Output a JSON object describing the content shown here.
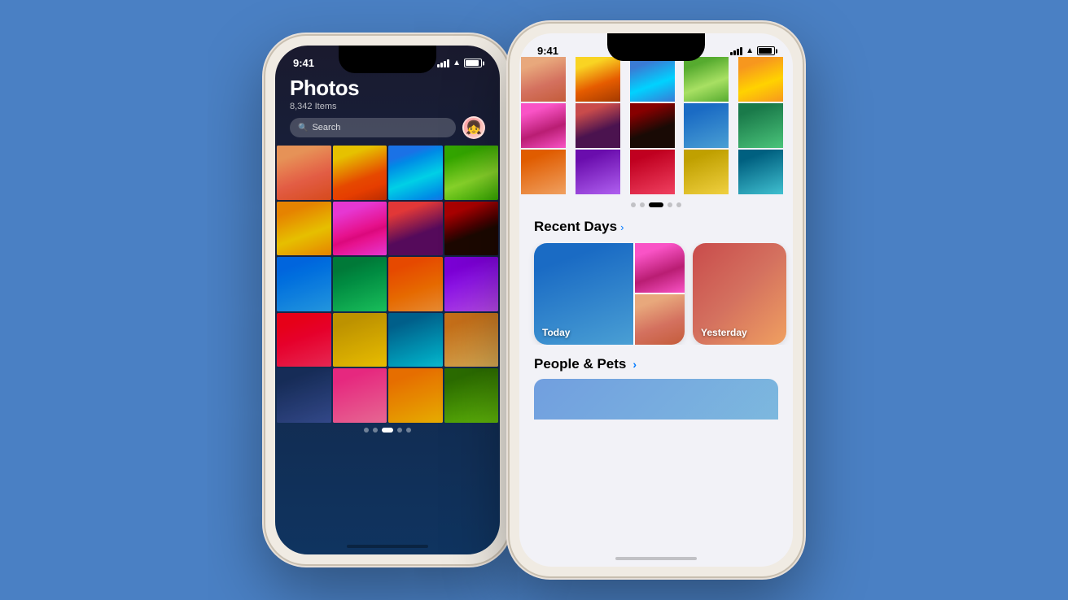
{
  "background_color": "#4a80c4",
  "left_phone": {
    "status": {
      "time": "9:41",
      "signal": "full",
      "wifi": true,
      "battery": "full"
    },
    "title": "Photos",
    "item_count": "8,342 Items",
    "search_placeholder": "Search",
    "dot_indicators": [
      "dot",
      "dot",
      "active",
      "dot",
      "dot"
    ],
    "photos": [
      {
        "color": "photo-warm1"
      },
      {
        "color": "photo-warm2"
      },
      {
        "color": "photo-cool1"
      },
      {
        "color": "photo-nature1"
      },
      {
        "color": "photo-sunset"
      },
      {
        "color": "photo-pink"
      },
      {
        "color": "photo-people1"
      },
      {
        "color": "photo-people2"
      },
      {
        "color": "photo-blue"
      },
      {
        "color": "photo-green"
      },
      {
        "color": "photo-orange"
      },
      {
        "color": "photo-purple"
      },
      {
        "color": "photo-red"
      },
      {
        "color": "photo-yellow"
      },
      {
        "color": "photo-teal"
      },
      {
        "color": "photo-sand"
      },
      {
        "color": "photo-dark"
      },
      {
        "color": "photo-bright"
      },
      {
        "color": "photo-mango"
      },
      {
        "color": "photo-grass"
      }
    ]
  },
  "right_phone": {
    "status": {
      "time": "9:41",
      "theme": "light"
    },
    "top_grid_photos": [
      {
        "color": "photo-warm1"
      },
      {
        "color": "photo-warm2"
      },
      {
        "color": "photo-cool1"
      },
      {
        "color": "photo-nature1"
      },
      {
        "color": "photo-sunset"
      },
      {
        "color": "photo-pink"
      },
      {
        "color": "photo-people1"
      },
      {
        "color": "photo-people2"
      },
      {
        "color": "photo-blue"
      },
      {
        "color": "photo-green"
      },
      {
        "color": "photo-orange"
      },
      {
        "color": "photo-purple"
      },
      {
        "color": "photo-red"
      },
      {
        "color": "photo-yellow"
      },
      {
        "color": "photo-teal"
      }
    ],
    "carousel_dots": [
      "dot",
      "dot",
      "active",
      "dot",
      "dot"
    ],
    "recent_days_label": "Recent Days",
    "today_label": "Today",
    "yesterday_label": "Yesterday",
    "people_pets_label": "People & Pets",
    "chevron": "›"
  }
}
